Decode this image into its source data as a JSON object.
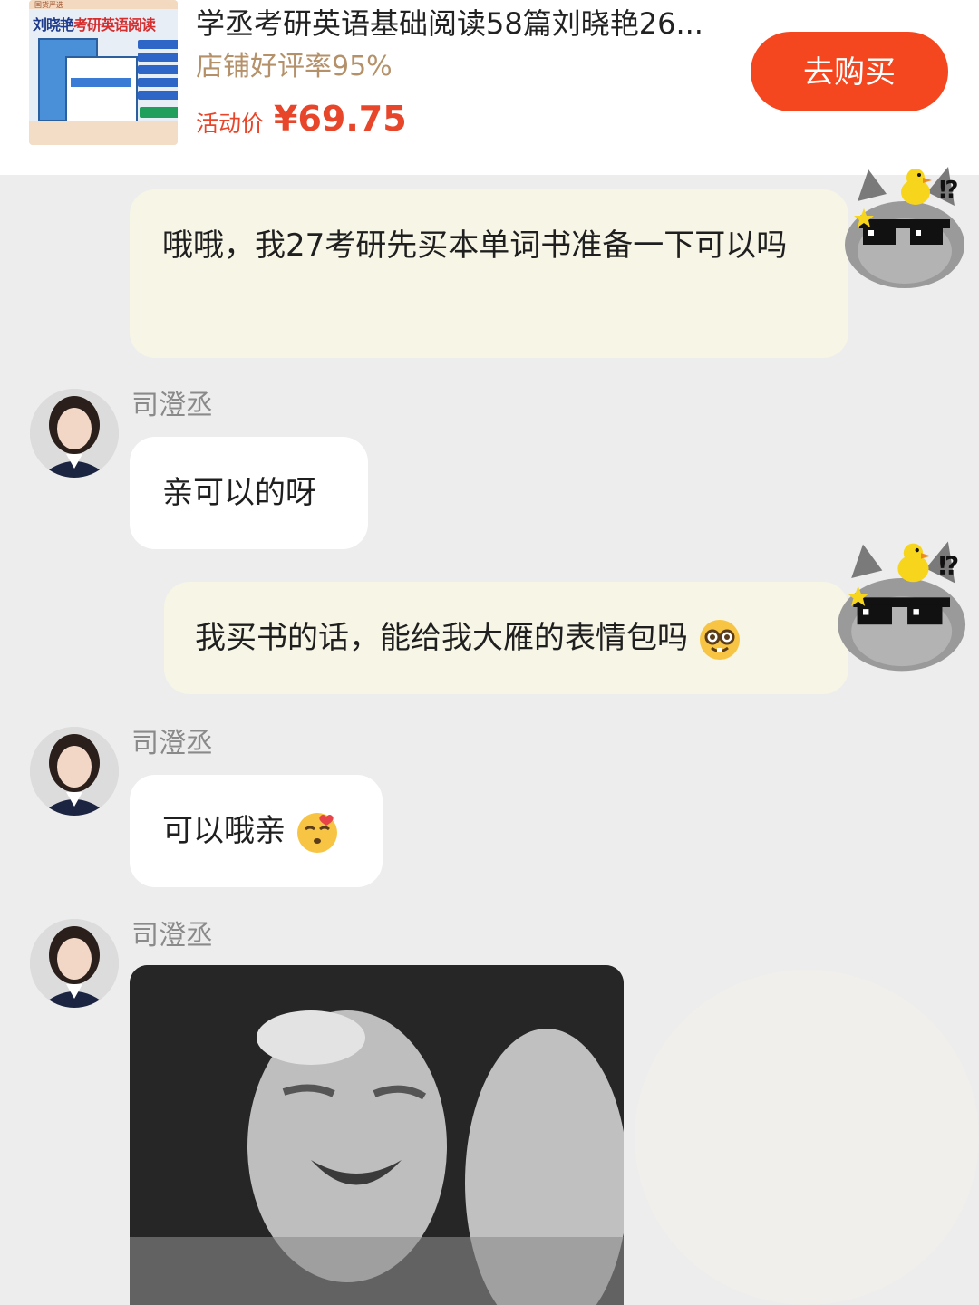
{
  "product": {
    "thumbnail_top_text": "国货严选",
    "thumbnail_title_left": "刘晓艳",
    "thumbnail_title_right": "考研英语阅读",
    "title": "学丞考研英语基础阅读58篇刘晓艳26...",
    "rating": "店铺好评率95%",
    "promo_label": "活动价",
    "promo_price": "¥69.75",
    "buy_label": "去购买"
  },
  "messages": [
    {
      "from": "me",
      "text": "哦哦，我27考研先买本单词书准备一下可以吗"
    },
    {
      "from": "other",
      "sender": "司澄丞",
      "text": "亲可以的呀"
    },
    {
      "from": "me",
      "text": "我买书的话，能给我大雁的表情包吗"
    },
    {
      "from": "other",
      "sender": "司澄丞",
      "text": "可以哦亲"
    },
    {
      "from": "other",
      "sender": "司澄丞",
      "type": "image"
    }
  ],
  "icons": {
    "me_avatar": "cool-cat-sticker-icon",
    "other_avatar": "woman-portrait-icon",
    "emoji_nerd": "nerd-face-emoji-icon",
    "emoji_kiss": "kissing-face-emoji-icon"
  },
  "colors": {
    "accent": "#f4471f",
    "price": "#e8462a",
    "my_bubble": "#f7f5e6",
    "other_bubble": "#ffffff",
    "background": "#ededed"
  }
}
